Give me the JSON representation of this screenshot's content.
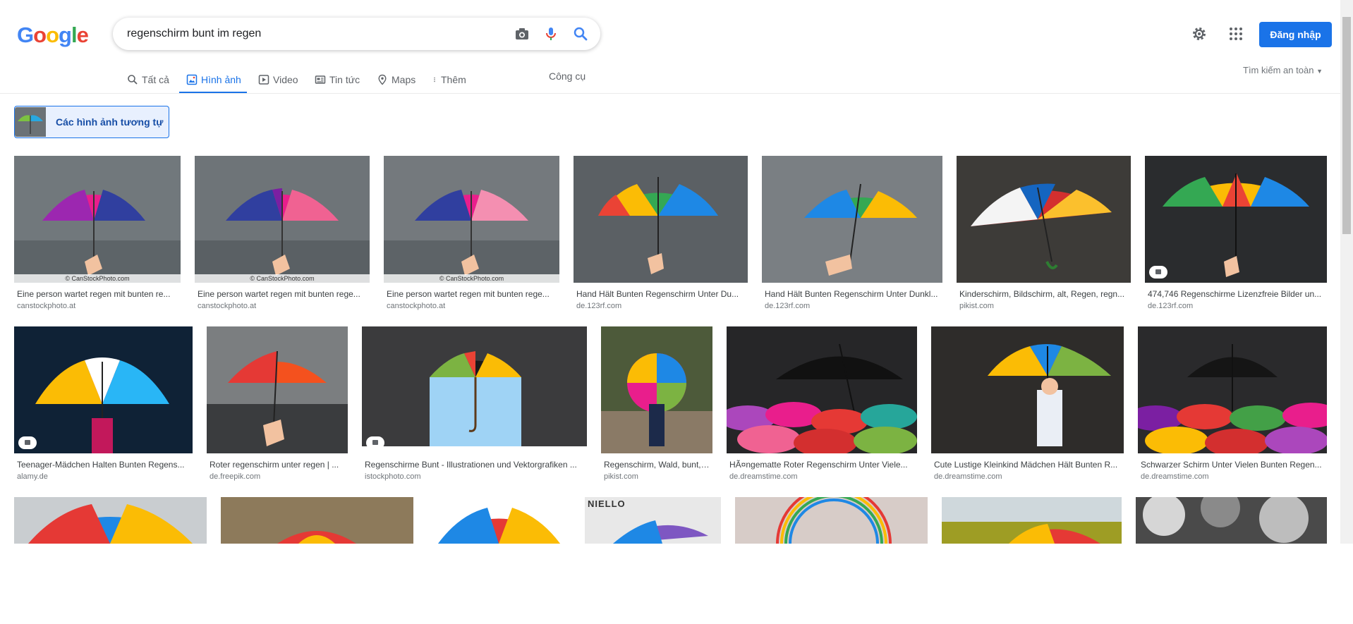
{
  "brand": {
    "logo_letters": [
      "G",
      "o",
      "o",
      "g",
      "l",
      "e"
    ],
    "logo_colors": [
      "#4285f4",
      "#ea4335",
      "#fbbc05",
      "#4285f4",
      "#34a853",
      "#ea4335"
    ],
    "accent": "#1a73e8"
  },
  "search": {
    "query": "regenschirm bunt im regen",
    "icons": [
      "camera-icon",
      "mic-icon",
      "search-icon"
    ]
  },
  "header": {
    "signin_label": "Đăng nhập",
    "settings_icon": "gear-icon",
    "apps_icon": "apps-grid-icon"
  },
  "tabs": [
    {
      "label": "Tất cả",
      "icon": "search-icon",
      "active": false
    },
    {
      "label": "Hình ảnh",
      "icon": "image-icon",
      "active": true
    },
    {
      "label": "Video",
      "icon": "video-icon",
      "active": false
    },
    {
      "label": "Tin tức",
      "icon": "news-icon",
      "active": false
    },
    {
      "label": "Maps",
      "icon": "pin-icon",
      "active": false
    },
    {
      "label": "Thêm",
      "icon": "more-vert-icon",
      "active": false
    }
  ],
  "tools_label": "Công cụ",
  "safe_search_label": "Tìm kiếm an toàn",
  "similar_label": "Các hình ảnh tương tự",
  "results": [
    {
      "title": "Eine person wartet regen mit bunten re...",
      "site": "canstockphoto.at",
      "watermark": "© CanStockPhoto.com"
    },
    {
      "title": "Eine person wartet regen mit bunten rege...",
      "site": "canstockphoto.at",
      "watermark": "© CanStockPhoto.com"
    },
    {
      "title": "Eine person wartet regen mit bunten rege...",
      "site": "canstockphoto.at",
      "watermark": "© CanStockPhoto.com"
    },
    {
      "title": "Hand Hält Bunten Regenschirm Unter Du...",
      "site": "de.123rf.com"
    },
    {
      "title": "Hand Hält Bunten Regenschirm Unter Dunkl...",
      "site": "de.123rf.com"
    },
    {
      "title": "Kinderschirm, Bildschirm, alt, Regen, regn...",
      "site": "pikist.com"
    },
    {
      "title": "474,746 Regenschirme Lizenzfreie Bilder un...",
      "site": "de.123rf.com"
    },
    {
      "title": "Teenager-Mädchen Halten Bunten Regens...",
      "site": "alamy.de"
    },
    {
      "title": "Roter regenschirm unter regen | ...",
      "site": "de.freepik.com"
    },
    {
      "title": "Regenschirme Bunt - Illustrationen und Vektorgrafiken ...",
      "site": "istockphoto.com"
    },
    {
      "title": "Regenschirm, Wald, bunt, ...",
      "site": "pikist.com"
    },
    {
      "title": "HÃ¤ngematte Roter Regenschirm Unter Viele...",
      "site": "de.dreamstime.com"
    },
    {
      "title": "Cute Lustige Kleinkind Mädchen Hält Bunten R...",
      "site": "de.dreamstime.com"
    },
    {
      "title": "Schwarzer Schirm Unter Vielen Bunten Regen...",
      "site": "de.dreamstime.com"
    }
  ],
  "row3_text": "NIELLO"
}
